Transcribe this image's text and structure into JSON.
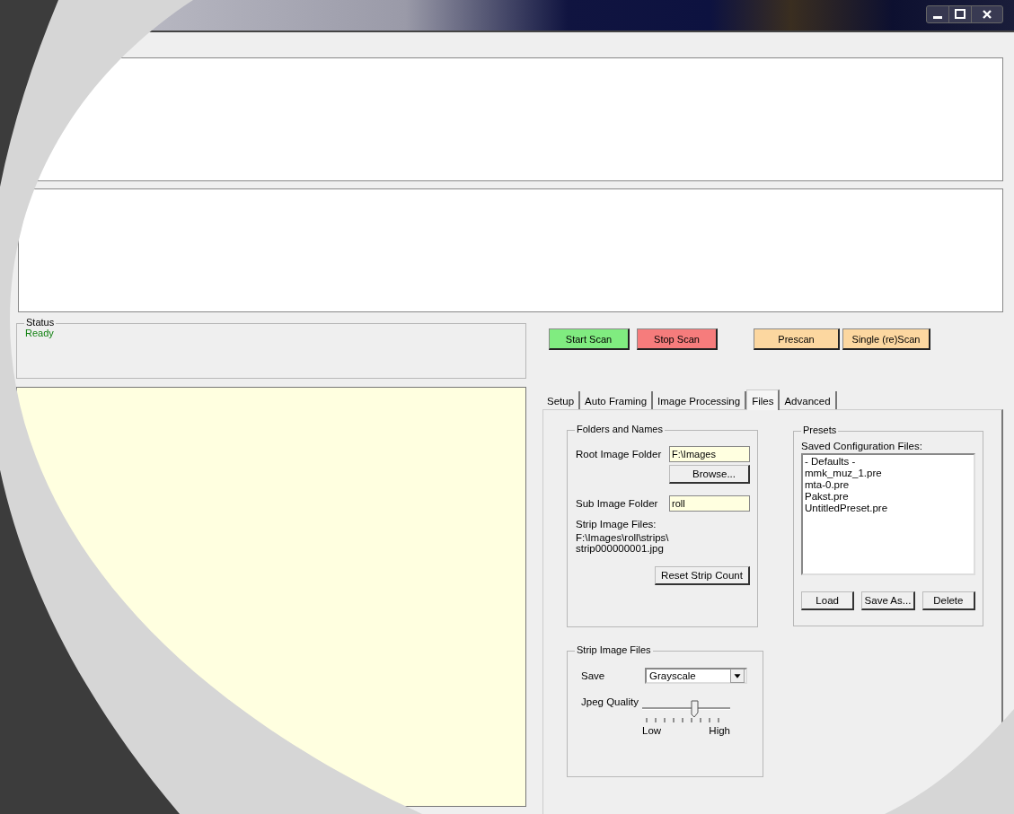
{
  "status": {
    "label": "Status",
    "text": "Ready"
  },
  "scan_buttons": [
    {
      "label": "Start Scan",
      "color": "#80ec80"
    },
    {
      "label": "Stop Scan",
      "color": "#f67c7c"
    },
    {
      "label": "Prescan",
      "color": "#fcd7a0"
    },
    {
      "label": "Single (re)Scan",
      "color": "#fcd7a0"
    }
  ],
  "tabs": [
    {
      "label": "Setup",
      "selected": false
    },
    {
      "label": "Auto Framing",
      "selected": false
    },
    {
      "label": "Image Processing",
      "selected": false
    },
    {
      "label": "Files",
      "selected": true
    },
    {
      "label": "Advanced",
      "selected": false
    }
  ],
  "folders": {
    "title": "Folders and Names",
    "root_label": "Root Image Folder",
    "root_value": "F:\\Images",
    "browse": "Browse...",
    "sub_label": "Sub Image Folder",
    "sub_value": "roll",
    "strip_label": "Strip Image Files:",
    "strip_path": "F:\\Images\\roll\\strips\\",
    "strip_file": "strip000000001.jpg",
    "reset": "Reset Strip Count"
  },
  "presets": {
    "title": "Presets",
    "list_label": "Saved Configuration Files:",
    "items": [
      "- Defaults -",
      "mmk_muz_1.pre",
      "mta-0.pre",
      "Pakst.pre",
      "UntitledPreset.pre"
    ],
    "buttons": [
      "Load",
      "Save As...",
      "Delete"
    ]
  },
  "strip_files": {
    "title": "Strip Image Files",
    "save_label": "Save",
    "save_value": "Grayscale",
    "quality_label": "Jpeg Quality",
    "level": 0.6,
    "low": "Low",
    "high": "High"
  }
}
